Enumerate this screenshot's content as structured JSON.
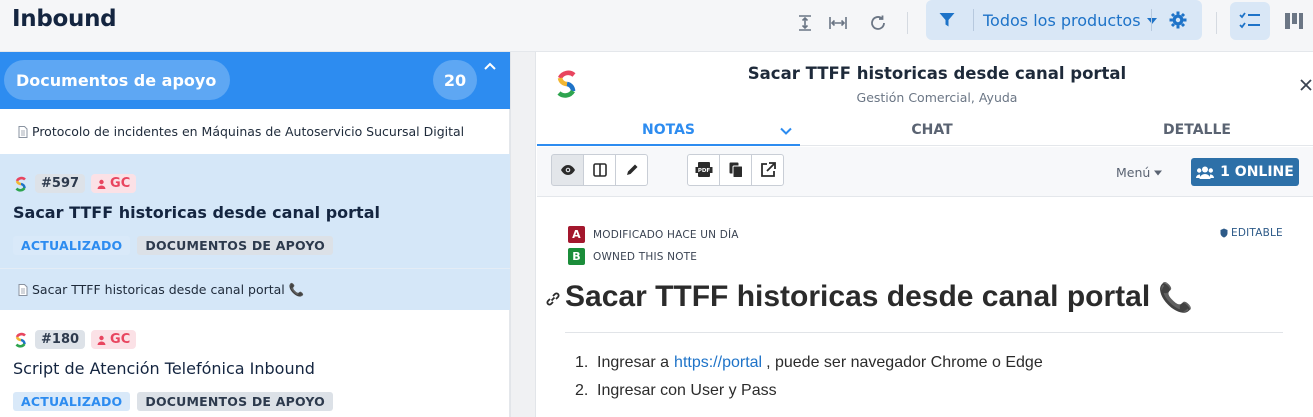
{
  "app": {
    "title": "Inbound"
  },
  "toolbar": {
    "product_filter": "Todos los productos"
  },
  "sidebar": {
    "section_title": "Documentos de apoyo",
    "count": "20",
    "top_doc": "Protocolo de incidentes en Máquinas de Autoservicio Sucursal Digital",
    "cards": [
      {
        "id": "#597",
        "badge": "GC",
        "title": "Sacar TTFF historicas desde canal portal",
        "tags": [
          "ACTUALIZADO",
          "DOCUMENTOS DE APOYO"
        ],
        "doc": "Sacar TTFF historicas desde canal portal 📞"
      },
      {
        "id": "#180",
        "badge": "GC",
        "title": "Script de Atención Telefónica Inbound",
        "tags": [
          "ACTUALIZADO",
          "DOCUMENTOS DE APOYO"
        ]
      }
    ]
  },
  "note": {
    "title": "Sacar TTFF historicas desde canal portal",
    "subtitle": "Gestión Comercial, Ayuda",
    "tabs": [
      "NOTAS",
      "CHAT",
      "DETALLE"
    ],
    "menu_label": "Menú",
    "online_label": "1 ONLINE",
    "meta": {
      "a_letter": "A",
      "a_text": "MODIFICADO HACE UN DÍA",
      "b_letter": "B",
      "b_text": "OWNED THIS NOTE",
      "editable": "EDITABLE"
    },
    "heading": "Sacar TTFF historicas desde canal portal",
    "heading_emoji": "📞",
    "steps": [
      {
        "num": "1.",
        "pre": "Ingresar a",
        "link": "https://portal",
        "post": ", puede ser navegador Chrome o Edge"
      },
      {
        "num": "2.",
        "pre": "Ingresar con User y Pass"
      }
    ]
  },
  "colors": {
    "accent": "#2d8cf0",
    "gc_badge": "#e8455f",
    "online": "#2d70a8"
  }
}
